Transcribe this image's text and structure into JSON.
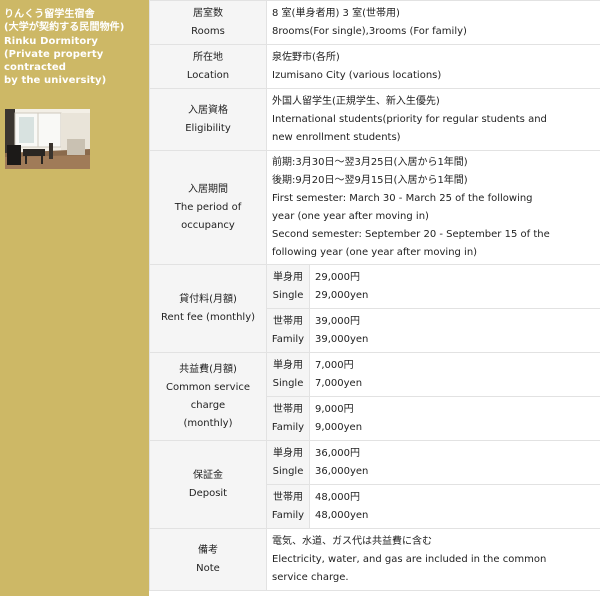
{
  "sidebar": {
    "title_lines": [
      "りんくう留学生宿舎",
      "(大学が契約する民間物件)",
      "Rinku Dormitory",
      "(Private property",
      "contracted",
      "by the university)"
    ]
  },
  "rows": {
    "rooms": {
      "label_ja": "居室数",
      "label_en": "Rooms",
      "value_lines": [
        "8 室(単身者用) 3 室(世帯用)",
        "8rooms(For single),3rooms (For family)"
      ]
    },
    "location": {
      "label_ja": "所在地",
      "label_en": "Location",
      "value_lines": [
        "泉佐野市(各所)",
        "Izumisano City (various locations)"
      ]
    },
    "eligibility": {
      "label_ja": "入居資格",
      "label_en": "Eligibility",
      "value_lines": [
        "外国人留学生(正規学生、新入生優先)",
        "International students(priority for regular students and",
        "new enrollment students)"
      ]
    },
    "period": {
      "label_ja": "入居期間",
      "label_en": "The period of occupancy",
      "value_lines": [
        "前期:3月30日〜翌3月25日(入居から1年間)",
        "後期:9月20日〜翌9月15日(入居から1年間)",
        "First semester: March 30 - March 25 of the following",
        "year (one year after moving in)",
        "Second semester: September 20 - September 15 of the",
        "following year (one year after moving in)"
      ]
    },
    "rent": {
      "label_ja": "貸付料(月額)",
      "label_en": "Rent fee (monthly)",
      "single": {
        "type_ja": "単身用",
        "type_en": "Single",
        "value_ja": "29,000円",
        "value_en": "29,000yen"
      },
      "family": {
        "type_ja": "世帯用",
        "type_en": "Family",
        "value_ja": "39,000円",
        "value_en": "39,000yen"
      }
    },
    "common": {
      "label_ja": "共益費(月額)",
      "label_en_1": "Common service",
      "label_en_2": "charge",
      "label_en_3": "(monthly)",
      "single": {
        "type_ja": "単身用",
        "type_en": "Single",
        "value_ja": "7,000円",
        "value_en": "7,000yen"
      },
      "family": {
        "type_ja": "世帯用",
        "type_en": "Family",
        "value_ja": "9,000円",
        "value_en": "9,000yen"
      }
    },
    "deposit": {
      "label_ja": "保証金",
      "label_en": "Deposit",
      "single": {
        "type_ja": "単身用",
        "type_en": "Single",
        "value_ja": "36,000円",
        "value_en": "36,000yen"
      },
      "family": {
        "type_ja": "世帯用",
        "type_en": "Family",
        "value_ja": "48,000円",
        "value_en": "48,000yen"
      }
    },
    "note": {
      "label_ja": "備考",
      "label_en": "Note",
      "value_lines": [
        "電気、水道、ガス代は共益費に含む",
        "Electricity, water, and gas are included in the common",
        "service charge."
      ]
    }
  }
}
